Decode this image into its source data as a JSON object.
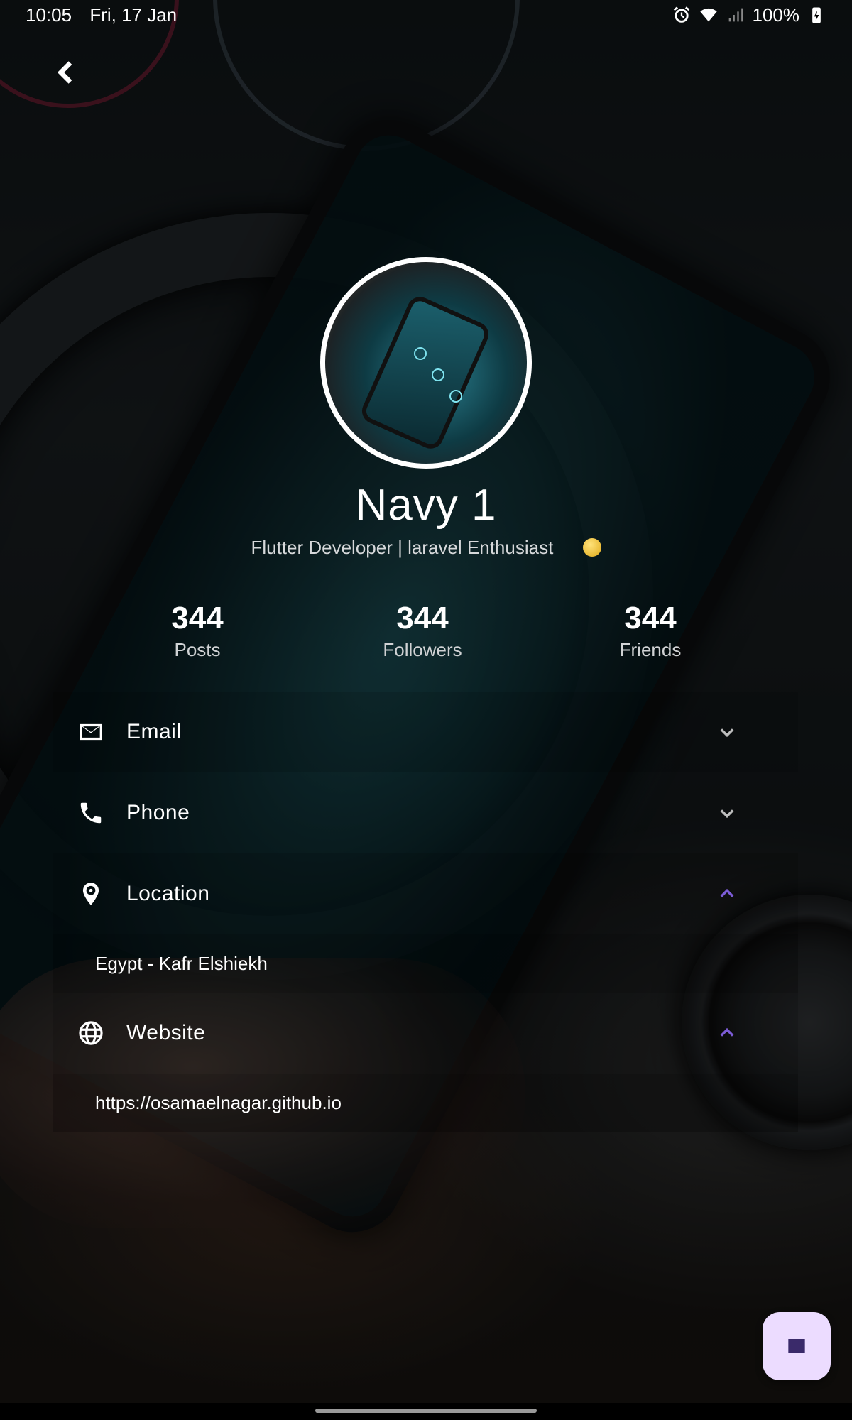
{
  "status_bar": {
    "time": "10:05",
    "date": "Fri, 17 Jan",
    "battery": "100%",
    "icons": [
      "alarm-icon",
      "wifi-icon",
      "signal-icon",
      "battery-charging-icon"
    ]
  },
  "profile": {
    "name": "Navy 1",
    "bio": "Flutter Developer | laravel Enthusiast",
    "bio_emoji": "grinning-face-icon"
  },
  "stats": [
    {
      "value": "344",
      "label": "Posts"
    },
    {
      "value": "344",
      "label": "Followers"
    },
    {
      "value": "344",
      "label": "Friends"
    }
  ],
  "info": {
    "email": {
      "label": "Email",
      "expanded": false
    },
    "phone": {
      "label": "Phone",
      "expanded": false
    },
    "location": {
      "label": "Location",
      "expanded": true,
      "value": "Egypt - Kafr Elshiekh"
    },
    "website": {
      "label": "Website",
      "expanded": true,
      "value": "https://osamaelnagar.github.io"
    }
  },
  "colors": {
    "accent": "#7c5cd6",
    "fab_bg": "#ecdcff",
    "fab_icon": "#3a2a6a"
  }
}
